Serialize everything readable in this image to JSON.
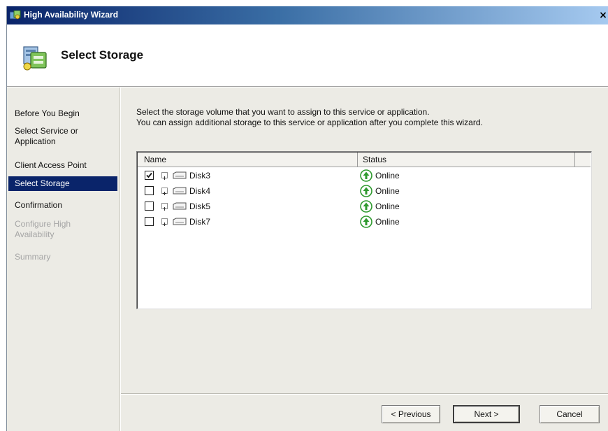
{
  "window": {
    "title": "High Availability Wizard",
    "close_glyph": "×",
    "app_icon": "cluster-wizard-icon"
  },
  "header": {
    "heading": "Select Storage",
    "icon": "storage-wizard-icon"
  },
  "sidebar": {
    "items": [
      {
        "label": "Before You Begin",
        "state": "normal"
      },
      {
        "label": "Select Service or Application",
        "state": "normal"
      },
      {
        "label": "Client Access Point",
        "state": "normal"
      },
      {
        "label": "Select Storage",
        "state": "active"
      },
      {
        "label": "Confirmation",
        "state": "normal"
      },
      {
        "label": "Configure High Availability",
        "state": "disabled"
      },
      {
        "label": "Summary",
        "state": "disabled"
      }
    ]
  },
  "main": {
    "description_line1": "Select the storage volume that you want to assign to this service or application.",
    "description_line2": "You can assign additional storage to this service or application after you complete this wizard.",
    "columns": [
      "Name",
      "Status"
    ],
    "disks": [
      {
        "name": "Disk3",
        "status": "Online",
        "checked": true
      },
      {
        "name": "Disk4",
        "status": "Online",
        "checked": false
      },
      {
        "name": "Disk5",
        "status": "Online",
        "checked": false
      },
      {
        "name": "Disk7",
        "status": "Online",
        "checked": false
      }
    ]
  },
  "buttons": {
    "previous": "< Previous",
    "next": "Next >",
    "cancel": "Cancel"
  },
  "colors": {
    "selection": "#0a246a",
    "status_online": "#2e9a2e",
    "panel": "#ecebe5"
  }
}
